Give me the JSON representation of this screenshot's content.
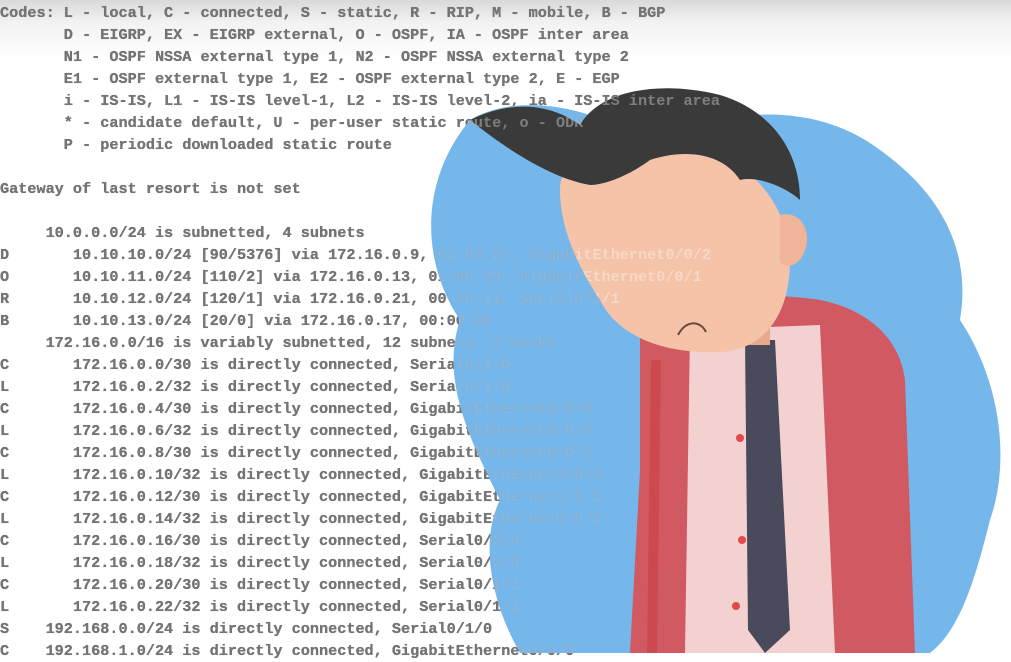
{
  "terminal": {
    "lines": [
      "Codes: L - local, C - connected, S - static, R - RIP, M - mobile, B - BGP",
      "       D - EIGRP, EX - EIGRP external, O - OSPF, IA - OSPF inter area",
      "       N1 - OSPF NSSA external type 1, N2 - OSPF NSSA external type 2",
      "       E1 - OSPF external type 1, E2 - OSPF external type 2, E - EGP",
      "       i - IS-IS, L1 - IS-IS level-1, L2 - IS-IS level-2, ia - IS-IS inter area",
      "       * - candidate default, U - per-user static route, o - ODR",
      "       P - periodic downloaded static route",
      "",
      "Gateway of last resort is not set",
      "",
      "     10.0.0.0/24 is subnetted, 4 subnets",
      "D       10.10.10.0/24 [90/5376] via 172.16.0.9, 01:02:27, GigabitEthernet0/0/2",
      "O       10.10.11.0/24 [110/2] via 172.16.0.13, 01:06:29, GigabitEthernet0/0/1",
      "R       10.10.12.0/24 [120/1] via 172.16.0.21, 00:00:11, Serial0/1/1",
      "B       10.10.13.0/24 [20/0] via 172.16.0.17, 00:00:00",
      "     172.16.0.0/16 is variably subnetted, 12 subnets, 2 masks",
      "C       172.16.0.0/30 is directly connected, Serial0/1/0",
      "L       172.16.0.2/32 is directly connected, Serial0/1/0",
      "C       172.16.0.4/30 is directly connected, GigabitEthernet0/0/0",
      "L       172.16.0.6/32 is directly connected, GigabitEthernet0/0/0",
      "C       172.16.0.8/30 is directly connected, GigabitEthernet0/0/2",
      "L       172.16.0.10/32 is directly connected, GigabitEthernet0/0/2",
      "C       172.16.0.12/30 is directly connected, GigabitEthernet0/0/1",
      "L       172.16.0.14/32 is directly connected, GigabitEthernet0/0/1",
      "C       172.16.0.16/30 is directly connected, Serial0/2/0",
      "L       172.16.0.18/32 is directly connected, Serial0/2/0",
      "C       172.16.0.20/30 is directly connected, Serial0/1/1",
      "L       172.16.0.22/32 is directly connected, Serial0/1/1",
      "S    192.168.0.0/24 is directly connected, Serial0/1/0",
      "C    192.168.1.0/24 is directly connected, GigabitEthernet0/0/0"
    ]
  },
  "illustration": {
    "subject": "confused person with hand on chin",
    "colors": {
      "background_blob": "#58a7e6",
      "hair": "#3a3a3a",
      "skin": "#f4c3a8",
      "jacket": "#e24a4a",
      "shirt": "#f7dede",
      "tie": "#3f4356"
    }
  }
}
